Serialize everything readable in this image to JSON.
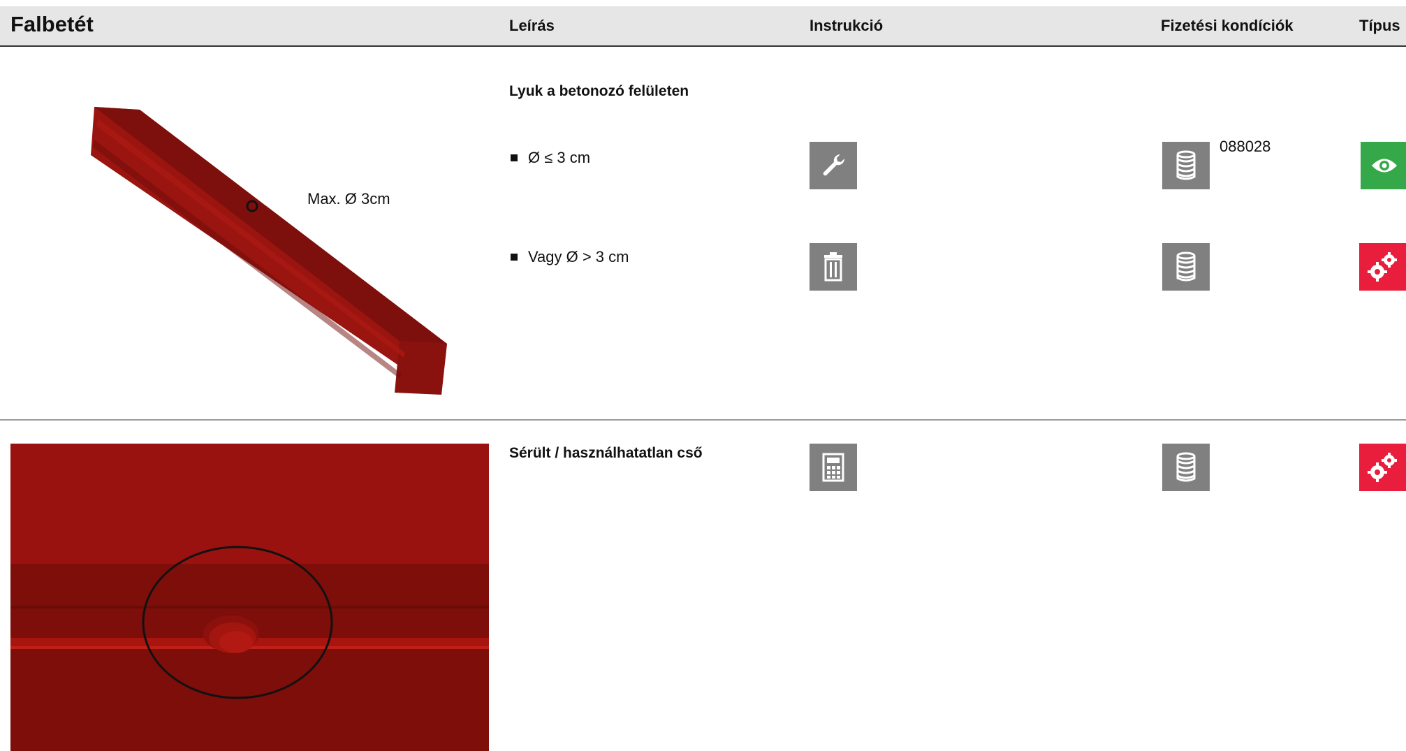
{
  "header": {
    "title": "Falbetét",
    "col_description": "Leírás",
    "col_instruction": "Instrukció",
    "col_payment": "Fizetési kondíciók",
    "col_type": "Típus"
  },
  "row1": {
    "image_label": "Max. Ø 3cm",
    "title": "Lyuk a betonozó felületen",
    "items": [
      {
        "label": "Ø ≤ 3 cm",
        "instruction_icon": "wrench-icon",
        "payment_icon": "coins-icon",
        "payment_code": "088028",
        "type_icon": "eye-icon"
      },
      {
        "label": "Vagy Ø > 3 cm",
        "instruction_icon": "trash-icon",
        "payment_icon": "coins-icon",
        "type_icon": "gears-icon"
      }
    ]
  },
  "row2": {
    "title": "Sérült / használhatatlan cső",
    "instruction_icon": "calculator-icon",
    "payment_icon": "coins-icon",
    "type_icon": "gears-icon"
  },
  "colors": {
    "header_bg": "#e6e6e6",
    "icon_gray": "#808080",
    "icon_green": "#35a94a",
    "icon_red": "#e81e3c",
    "product_red": "#9a1410"
  }
}
